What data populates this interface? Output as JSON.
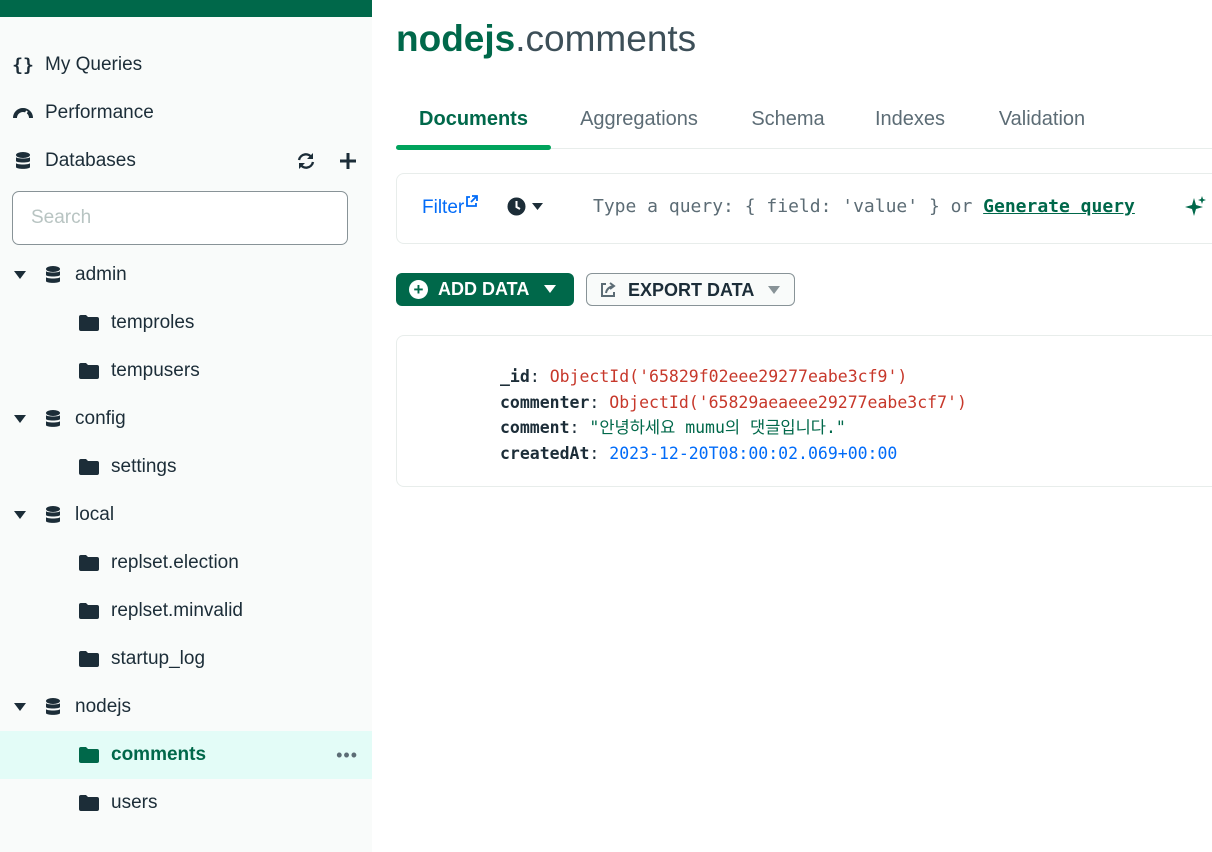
{
  "sidebar": {
    "nav": [
      {
        "label": "My Queries",
        "icon": "braces-icon"
      },
      {
        "label": "Performance",
        "icon": "gauge-icon"
      }
    ],
    "databases_label": "Databases",
    "search_placeholder": "Search",
    "tree": [
      {
        "db": "admin",
        "collections": [
          "temproles",
          "tempusers"
        ]
      },
      {
        "db": "config",
        "collections": [
          "settings"
        ]
      },
      {
        "db": "local",
        "collections": [
          "replset.election",
          "replset.minvalid",
          "startup_log"
        ]
      },
      {
        "db": "nodejs",
        "collections": [
          "comments",
          "users"
        ]
      }
    ],
    "active_collection": "comments"
  },
  "header": {
    "db_name": "nodejs",
    "separator": ".",
    "collection_name": "comments"
  },
  "tabs": [
    {
      "label": "Documents",
      "active": true
    },
    {
      "label": "Aggregations",
      "active": false
    },
    {
      "label": "Schema",
      "active": false
    },
    {
      "label": "Indexes",
      "active": false
    },
    {
      "label": "Validation",
      "active": false
    }
  ],
  "filter": {
    "label": "Filter",
    "placeholder_prefix": "Type a query: { field: 'value' } or ",
    "generate_link": "Generate query"
  },
  "toolbar": {
    "add_data": "ADD DATA",
    "export_data": "EXPORT DATA"
  },
  "document": {
    "fields": [
      {
        "key": "_id",
        "value": "ObjectId('65829f02eee29277eabe3cf9')",
        "type": "oid"
      },
      {
        "key": "commenter",
        "value": "ObjectId('65829aeaeee29277eabe3cf7')",
        "type": "oid"
      },
      {
        "key": "comment",
        "value": "\"안녕하세요 mumu의 댓글입니다.\"",
        "type": "str"
      },
      {
        "key": "createdAt",
        "value": "2023-12-20T08:00:02.069+00:00",
        "type": "date"
      }
    ]
  },
  "colors": {
    "brand": "#00684a",
    "tab_underline": "#00a35c",
    "link": "#016bf8",
    "objectid": "#c7382b",
    "active_bg": "#e3fcf7"
  }
}
